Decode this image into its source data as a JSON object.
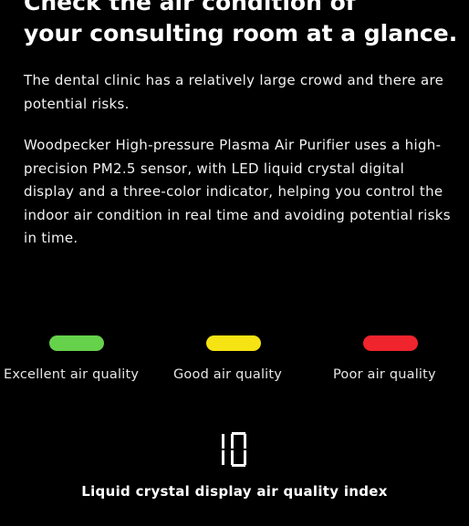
{
  "heading": {
    "line1": "Check the air condition of",
    "line2": "your consulting room at a glance."
  },
  "paragraphs": [
    "The dental clinic has a relatively large crowd and there are potential risks.",
    "Woodpecker High-pressure Plasma Air Purifier uses a high-precision PM2.5 sensor, with LED liquid crystal digital display and a three-color indicator, helping you control the indoor air condition in real time and avoiding potential risks in time."
  ],
  "indicators": [
    {
      "label": "Excellent air quality",
      "color": "#66d14a"
    },
    {
      "label": "Good air quality",
      "color": "#f5e313"
    },
    {
      "label": "Poor air quality",
      "color": "#f0242c"
    }
  ],
  "display": {
    "value": "10",
    "caption": "Liquid crystal display air quality index"
  }
}
